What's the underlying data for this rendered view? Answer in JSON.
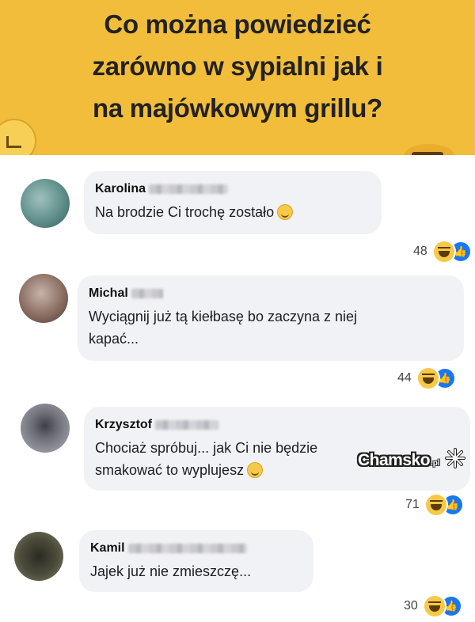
{
  "banner": {
    "title_line1": "Co można powiedzieć",
    "title_line2": "zarówno w sypialni jak i",
    "title_line3": "na majówkowym grillu?"
  },
  "comments": [
    {
      "name": "Karolina",
      "text": "Na brodzie Ci trochę zostało",
      "reactions": "48",
      "avatar_color": "#5f8f8a"
    },
    {
      "name": "Michal",
      "text_line1": "Wyciągnij już tą kiełbasę bo zaczyna z niej",
      "text_line2": "kapać...",
      "reactions": "44",
      "avatar_color": "#8a6e62"
    },
    {
      "name": "Krzysztof",
      "text_line1": "Chociaż spróbuj... jak Ci nie będzie",
      "text_line2": "smakować to wyplujesz",
      "reactions": "71",
      "avatar_color": "#6d6e76"
    },
    {
      "name": "Kamil",
      "text": "Jajek już nie zmieszczę...",
      "reactions": "30",
      "avatar_color": "#4b4a3a"
    }
  ],
  "watermark": {
    "text": "Chamsko",
    "suffix": ".pl"
  },
  "colors": {
    "banner": "#f2bd3a",
    "bubble": "#f0f2f5",
    "like": "#1877f2",
    "haha": "#f7c948"
  },
  "icons": [
    "haha-reaction-icon",
    "like-reaction-icon",
    "smile-emoji-icon",
    "wink-emoji-icon"
  ]
}
